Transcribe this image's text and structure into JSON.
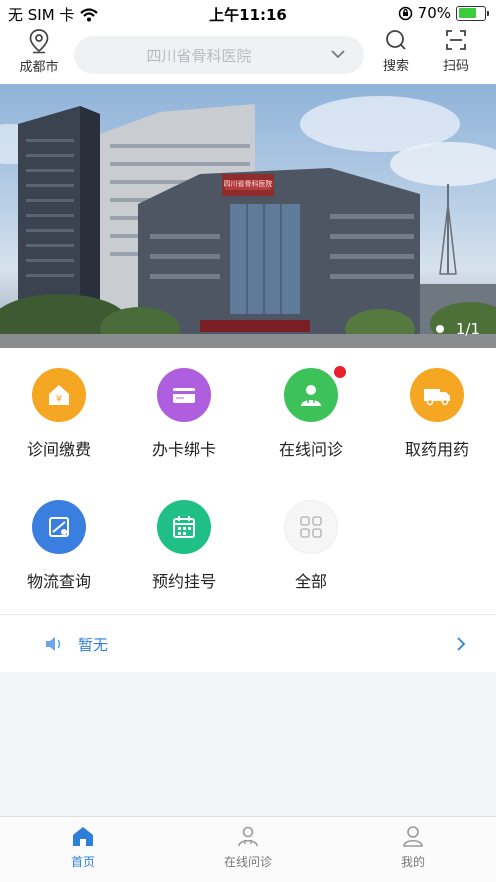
{
  "status_bar": {
    "carrier": "无 SIM 卡",
    "time": "上午11:16",
    "battery_percent_label": "70%",
    "battery_level": 0.7
  },
  "header": {
    "location_label": "成都市",
    "search_placeholder": "四川省骨科医院",
    "search_button_label": "搜索",
    "scan_button_label": "扫码"
  },
  "banner": {
    "sign_text": "四川省骨科医院",
    "pager_text": "1/1"
  },
  "services": [
    {
      "label": "诊间缴费",
      "icon": "yuan-house-icon",
      "color": "#f5a623"
    },
    {
      "label": "办卡绑卡",
      "icon": "card-icon",
      "color": "#b05ee0"
    },
    {
      "label": "在线问诊",
      "icon": "doctor-icon",
      "color": "#3dc25a",
      "badge": true
    },
    {
      "label": "取药用药",
      "icon": "truck-icon",
      "color": "#f5a623"
    },
    {
      "label": "物流查询",
      "icon": "logistics-icon",
      "color": "#3a7fe0"
    },
    {
      "label": "预约挂号",
      "icon": "calendar-icon",
      "color": "#1fbf86"
    },
    {
      "label": "全部",
      "icon": "grid-icon",
      "color": "#f2f2f2"
    }
  ],
  "notice": {
    "text": "暂无"
  },
  "tabbar": {
    "home_label": "首页",
    "consult_label": "在线问诊",
    "mine_label": "我的"
  },
  "colors": {
    "accent": "#2f7fd8",
    "badge": "#e8202a"
  }
}
